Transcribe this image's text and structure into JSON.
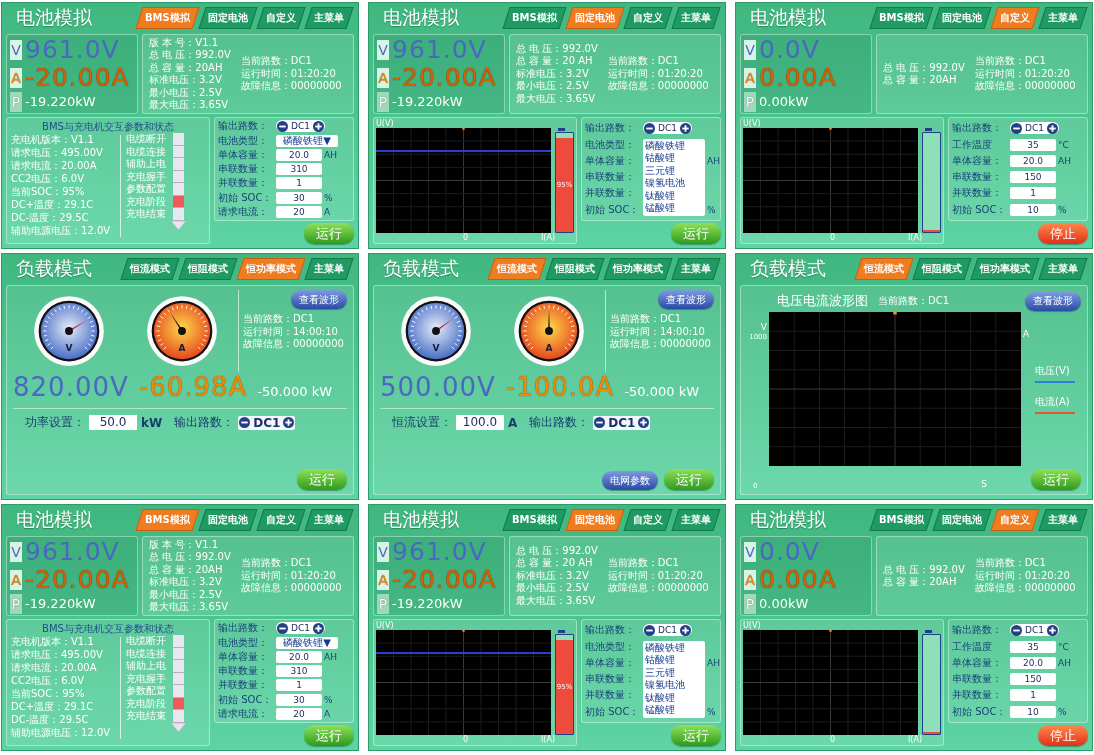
{
  "screens": [
    {
      "kind": "battery",
      "title": "电池模拟",
      "tabs": [
        {
          "label": "BMS模拟",
          "selected": true
        },
        {
          "label": "固定电池",
          "selected": false
        },
        {
          "label": "自定义",
          "selected": false
        },
        {
          "label": "主菜单",
          "selected": false
        }
      ],
      "readings": [
        {
          "kind": "voltage",
          "unit": "V",
          "value": "961.0V"
        },
        {
          "kind": "current",
          "unit": "A",
          "value": "-20.00A"
        },
        {
          "kind": "power",
          "unit": "P",
          "value": "-19.220kW"
        }
      ],
      "info_left": [
        "版 本 号：V1.1",
        "总 电 压：992.0V",
        "总 容 量：20AH",
        "标准电压：3.2V",
        "最小电压：2.5V",
        "最大电压：3.65V"
      ],
      "info_right": [
        "当前路数：DC1",
        "运行时间：01:20:20",
        "故障信息：00000000"
      ],
      "bottom": {
        "kind": "bms",
        "heading": "BMS与充电机交互参数和状态",
        "params": [
          "充电机版本：V1.1",
          "请求电压：495.00V",
          "请求电流：20.00A",
          "CC2电压：6.0V",
          "当前SOC：95%",
          "DC+温度：29.1C",
          "DC-温度：29.5C",
          "辅助电源电压：12.0V"
        ],
        "stages": [
          {
            "label": "电缆断开",
            "active": false
          },
          {
            "label": "电缆连接",
            "active": false
          },
          {
            "label": "辅助上电",
            "active": false
          },
          {
            "label": "充电握手",
            "active": false
          },
          {
            "label": "参数配置",
            "active": false
          },
          {
            "label": "充电阶段",
            "active": true
          },
          {
            "label": "充电结束",
            "active": false
          }
        ]
      },
      "settings": [
        {
          "kind": "stepper",
          "label": "输出路数：",
          "value": "DC1"
        },
        {
          "kind": "select",
          "label": "电池类型：",
          "value": "磷酸铁锂▼",
          "expanded": false
        },
        {
          "kind": "input",
          "label": "单体容量：",
          "value": "20.0",
          "unit": "AH"
        },
        {
          "kind": "input",
          "label": "串联数量：",
          "value": "310"
        },
        {
          "kind": "input",
          "label": "并联数量：",
          "value": "1"
        },
        {
          "kind": "input",
          "label": "初始 SOC：",
          "value": "30",
          "unit": "%"
        },
        {
          "kind": "input",
          "label": "请求电流：",
          "value": "20",
          "unit": "A"
        }
      ],
      "buttons": [
        {
          "kind": "run",
          "label": "运行"
        }
      ]
    },
    {
      "kind": "battery",
      "title": "电池模拟",
      "tabs": [
        {
          "label": "BMS模拟",
          "selected": false
        },
        {
          "label": "固定电池",
          "selected": true
        },
        {
          "label": "自定义",
          "selected": false
        },
        {
          "label": "主菜单",
          "selected": false
        }
      ],
      "readings": [
        {
          "kind": "voltage",
          "unit": "V",
          "value": "961.0V"
        },
        {
          "kind": "current",
          "unit": "A",
          "value": "-20.00A"
        },
        {
          "kind": "power",
          "unit": "P",
          "value": "-19.220kW"
        }
      ],
      "info_left": [
        "总 电 压：992.0V",
        "总 容 量：20 AH",
        "标准电压：3.2V",
        "最小电压：2.5V",
        "最大电压：3.65V"
      ],
      "info_right": [
        "当前路数：DC1",
        "运行时间：01:20:20",
        "故障信息：00000000"
      ],
      "bottom": {
        "kind": "scope",
        "y_label": "U(V)",
        "x_origin": "0",
        "x_label": "I(A)",
        "voltage_trace": true,
        "battery": {
          "level": 0.95,
          "label": "95%"
        }
      },
      "settings": [
        {
          "kind": "stepper",
          "label": "输出路数：",
          "value": "DC1"
        },
        {
          "kind": "select",
          "label": "电池类型：",
          "expanded": true,
          "options": [
            "磷酸铁锂",
            "钴酸锂",
            "三元锂",
            "镍氢电池",
            "钛酸锂",
            "锰酸锂"
          ]
        },
        {
          "kind": "input",
          "label": "单体容量：",
          "unit": "AH"
        },
        {
          "kind": "input",
          "label": "串联数量："
        },
        {
          "kind": "input",
          "label": "并联数量："
        },
        {
          "kind": "input",
          "label": "初始 SOC：",
          "unit": "%"
        }
      ],
      "buttons": [
        {
          "kind": "run",
          "label": "运行"
        }
      ]
    },
    {
      "kind": "battery",
      "title": "电池模拟",
      "tabs": [
        {
          "label": "BMS模拟",
          "selected": false
        },
        {
          "label": "固定电池",
          "selected": false
        },
        {
          "label": "自定义",
          "selected": true
        },
        {
          "label": "主菜单",
          "selected": false
        }
      ],
      "readings": [
        {
          "kind": "voltage",
          "unit": "V",
          "value": "0.0V"
        },
        {
          "kind": "current",
          "unit": "A",
          "value": "0.00A"
        },
        {
          "kind": "power",
          "unit": "P",
          "value": "0.00kW"
        }
      ],
      "info_left": [
        "总 电 压：992.0V",
        "总 容 量：20AH"
      ],
      "info_right": [
        "当前路数：DC1",
        "运行时间：01:20:20",
        "故障信息：00000000"
      ],
      "bottom": {
        "kind": "scope",
        "y_label": "U(V)",
        "x_origin": "0",
        "x_label": "I(A)",
        "voltage_trace": false,
        "battery": {
          "level": 0
        }
      },
      "settings": [
        {
          "kind": "stepper",
          "label": "输出路数：",
          "value": "DC1"
        },
        {
          "kind": "input",
          "label": "工作温度",
          "value": "35",
          "unit": "°C"
        },
        {
          "kind": "input",
          "label": "单体容量：",
          "value": "20.0",
          "unit": "AH"
        },
        {
          "kind": "input",
          "label": "串联数量：",
          "value": "150"
        },
        {
          "kind": "input",
          "label": "并联数量：",
          "value": "1"
        },
        {
          "kind": "input",
          "label": "初始 SOC：",
          "value": "10",
          "unit": "%"
        }
      ],
      "buttons": [
        {
          "kind": "stop",
          "label": "停止"
        }
      ]
    },
    {
      "kind": "load",
      "title": "负载模式",
      "tabs": [
        {
          "label": "恒流模式",
          "selected": false
        },
        {
          "label": "恒阻模式",
          "selected": false
        },
        {
          "label": "恒功率模式",
          "selected": true
        },
        {
          "label": "主菜单",
          "selected": false
        }
      ],
      "body": {
        "kind": "gauges",
        "wave_button": "查看波形",
        "gauges": [
          {
            "kind": "voltage",
            "unit": "V",
            "level": 0.72
          },
          {
            "kind": "current",
            "unit": "A",
            "level": 0.38
          }
        ],
        "info": [
          "当前路数：DC1",
          "运行时间：14:00:10",
          "故障信息：00000000"
        ],
        "readings": [
          {
            "kind": "voltage",
            "value": "820.00V"
          },
          {
            "kind": "current",
            "value": "-60.98A"
          },
          {
            "kind": "power",
            "value": "-50.000 kW"
          }
        ],
        "setting": {
          "label": "功率设置：",
          "value": "50.0",
          "unit": "kW"
        },
        "channel": {
          "label": "输出路数：",
          "value": "DC1"
        }
      },
      "buttons": [
        {
          "kind": "run",
          "label": "运行"
        }
      ]
    },
    {
      "kind": "load",
      "title": "负载模式",
      "tabs": [
        {
          "label": "恒流模式",
          "selected": true
        },
        {
          "label": "恒阻模式",
          "selected": false
        },
        {
          "label": "恒功率模式",
          "selected": false
        },
        {
          "label": "主菜单",
          "selected": false
        }
      ],
      "body": {
        "kind": "gauges",
        "wave_button": "查看波形",
        "gauges": [
          {
            "kind": "voltage",
            "unit": "V",
            "level": 0.7
          },
          {
            "kind": "current",
            "unit": "A",
            "level": 0.5
          }
        ],
        "info": [
          "当前路数：DC1",
          "运行时间：14:00:10",
          "故障信息：00000000"
        ],
        "readings": [
          {
            "kind": "voltage",
            "value": "500.00V"
          },
          {
            "kind": "current",
            "value": "-100.0A"
          },
          {
            "kind": "power",
            "value": "-50.000 kW"
          }
        ],
        "setting": {
          "label": "恒流设置：",
          "value": "100.0",
          "unit": "A"
        },
        "channel": {
          "label": "输出路数：",
          "value": "DC1"
        }
      },
      "buttons": [
        {
          "kind": "secondary",
          "label": "电网参数"
        },
        {
          "kind": "run",
          "label": "运行"
        }
      ]
    },
    {
      "kind": "load",
      "title": "负载模式",
      "tabs": [
        {
          "label": "恒流模式",
          "selected": true
        },
        {
          "label": "恒阻模式",
          "selected": false
        },
        {
          "label": "恒功率模式",
          "selected": false
        },
        {
          "label": "主菜单",
          "selected": false
        }
      ],
      "body": {
        "kind": "waveform",
        "title": "电压电流波形图",
        "channel": "当前路数：DC1",
        "wave_button": "查看波形",
        "y_label": "V",
        "y_max": "1000",
        "y_min": "0",
        "y2_label": "A",
        "x_label": "S",
        "legend": [
          {
            "label": "电压(V)",
            "color": "#2f7fd6"
          },
          {
            "label": "电流(A)",
            "color": "#e2572b"
          }
        ]
      },
      "buttons": [
        {
          "kind": "run",
          "label": "运行"
        }
      ]
    },
    {
      "kind": "battery",
      "title": "电池模拟",
      "tabs": [
        {
          "label": "BMS模拟",
          "selected": true
        },
        {
          "label": "固定电池",
          "selected": false
        },
        {
          "label": "自定义",
          "selected": false
        },
        {
          "label": "主菜单",
          "selected": false
        }
      ],
      "readings": [
        {
          "kind": "voltage",
          "unit": "V",
          "value": "961.0V"
        },
        {
          "kind": "current",
          "unit": "A",
          "value": "-20.00A"
        },
        {
          "kind": "power",
          "unit": "P",
          "value": "-19.220kW"
        }
      ],
      "info_left": [
        "版 本 号：V1.1",
        "总 电 压：992.0V",
        "总 容 量：20AH",
        "标准电压：3.2V",
        "最小电压：2.5V",
        "最大电压：3.65V"
      ],
      "info_right": [
        "当前路数：DC1",
        "运行时间：01:20:20",
        "故障信息：00000000"
      ],
      "bottom": {
        "kind": "bms",
        "heading": "BMS与充电机交互参数和状态",
        "params": [
          "充电机版本：V1.1",
          "请求电压：495.00V",
          "请求电流：20.00A",
          "CC2电压：6.0V",
          "当前SOC：95%",
          "DC+温度：29.1C",
          "DC-温度：29.5C",
          "辅助电源电压：12.0V"
        ],
        "stages": [
          {
            "label": "电缆断开",
            "active": false
          },
          {
            "label": "电缆连接",
            "active": false
          },
          {
            "label": "辅助上电",
            "active": false
          },
          {
            "label": "充电握手",
            "active": false
          },
          {
            "label": "参数配置",
            "active": false
          },
          {
            "label": "充电阶段",
            "active": true
          },
          {
            "label": "充电结束",
            "active": false
          }
        ]
      },
      "settings": [
        {
          "kind": "stepper",
          "label": "输出路数：",
          "value": "DC1"
        },
        {
          "kind": "select",
          "label": "电池类型：",
          "value": "磷酸铁锂▼",
          "expanded": false
        },
        {
          "kind": "input",
          "label": "单体容量：",
          "value": "20.0",
          "unit": "AH"
        },
        {
          "kind": "input",
          "label": "串联数量：",
          "value": "310"
        },
        {
          "kind": "input",
          "label": "并联数量：",
          "value": "1"
        },
        {
          "kind": "input",
          "label": "初始 SOC：",
          "value": "30",
          "unit": "%"
        },
        {
          "kind": "input",
          "label": "请求电流：",
          "value": "20",
          "unit": "A"
        }
      ],
      "buttons": [
        {
          "kind": "run",
          "label": "运行"
        }
      ]
    },
    {
      "kind": "battery",
      "title": "电池模拟",
      "tabs": [
        {
          "label": "BMS模拟",
          "selected": false
        },
        {
          "label": "固定电池",
          "selected": true
        },
        {
          "label": "自定义",
          "selected": false
        },
        {
          "label": "主菜单",
          "selected": false
        }
      ],
      "readings": [
        {
          "kind": "voltage",
          "unit": "V",
          "value": "961.0V"
        },
        {
          "kind": "current",
          "unit": "A",
          "value": "-20.00A"
        },
        {
          "kind": "power",
          "unit": "P",
          "value": "-19.220kW"
        }
      ],
      "info_left": [
        "总 电 压：992.0V",
        "总 容 量：20 AH",
        "标准电压：3.2V",
        "最小电压：2.5V",
        "最大电压：3.65V"
      ],
      "info_right": [
        "当前路数：DC1",
        "运行时间：01:20:20",
        "故障信息：00000000"
      ],
      "bottom": {
        "kind": "scope",
        "y_label": "U(V)",
        "x_origin": "0",
        "x_label": "I(A)",
        "voltage_trace": true,
        "battery": {
          "level": 0.95,
          "label": "95%"
        }
      },
      "settings": [
        {
          "kind": "stepper",
          "label": "输出路数：",
          "value": "DC1"
        },
        {
          "kind": "select",
          "label": "电池类型：",
          "expanded": true,
          "options": [
            "磷酸铁锂",
            "钴酸锂",
            "三元锂",
            "镍氢电池",
            "钛酸锂",
            "锰酸锂"
          ]
        },
        {
          "kind": "input",
          "label": "单体容量：",
          "unit": "AH"
        },
        {
          "kind": "input",
          "label": "串联数量："
        },
        {
          "kind": "input",
          "label": "并联数量："
        },
        {
          "kind": "input",
          "label": "初始 SOC：",
          "unit": "%"
        }
      ],
      "buttons": [
        {
          "kind": "run",
          "label": "运行"
        }
      ]
    },
    {
      "kind": "battery",
      "title": "电池模拟",
      "tabs": [
        {
          "label": "BMS模拟",
          "selected": false
        },
        {
          "label": "固定电池",
          "selected": false
        },
        {
          "label": "自定义",
          "selected": true
        },
        {
          "label": "主菜单",
          "selected": false
        }
      ],
      "readings": [
        {
          "kind": "voltage",
          "unit": "V",
          "value": "0.0V"
        },
        {
          "kind": "current",
          "unit": "A",
          "value": "0.00A"
        },
        {
          "kind": "power",
          "unit": "P",
          "value": "0.00kW"
        }
      ],
      "info_left": [
        "总 电 压：992.0V",
        "总 容 量：20AH"
      ],
      "info_right": [
        "当前路数：DC1",
        "运行时间：01:20:20",
        "故障信息：00000000"
      ],
      "bottom": {
        "kind": "scope",
        "y_label": "U(V)",
        "x_origin": "0",
        "x_label": "I(A)",
        "voltage_trace": false,
        "battery": {
          "level": 0
        }
      },
      "settings": [
        {
          "kind": "stepper",
          "label": "输出路数：",
          "value": "DC1"
        },
        {
          "kind": "input",
          "label": "工作温度",
          "value": "35",
          "unit": "°C"
        },
        {
          "kind": "input",
          "label": "单体容量：",
          "value": "20.0",
          "unit": "AH"
        },
        {
          "kind": "input",
          "label": "串联数量：",
          "value": "150"
        },
        {
          "kind": "input",
          "label": "并联数量：",
          "value": "1"
        },
        {
          "kind": "input",
          "label": "初始 SOC：",
          "value": "10",
          "unit": "%"
        }
      ],
      "buttons": [
        {
          "kind": "stop",
          "label": "停止"
        }
      ]
    }
  ]
}
